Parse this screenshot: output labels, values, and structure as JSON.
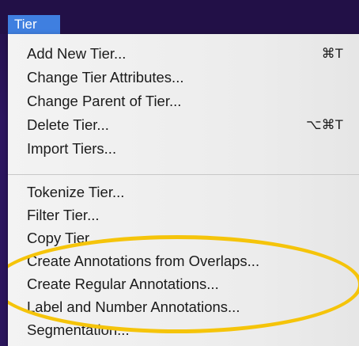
{
  "menu": {
    "title": "Tier",
    "items": [
      {
        "label": "Add New Tier...",
        "shortcut": "⌘T"
      },
      {
        "label": "Change Tier Attributes...",
        "shortcut": ""
      },
      {
        "label": "Change Parent of Tier...",
        "shortcut": ""
      },
      {
        "label": "Delete Tier...",
        "shortcut": "⌥⌘T"
      },
      {
        "label": "Import Tiers...",
        "shortcut": ""
      },
      {
        "label": "Tokenize Tier...",
        "shortcut": ""
      },
      {
        "label": "Filter Tier...",
        "shortcut": ""
      },
      {
        "label": "Copy Tier...",
        "shortcut": ""
      },
      {
        "label": "Create Annotations from Overlaps...",
        "shortcut": ""
      },
      {
        "label": "Create Regular Annotations...",
        "shortcut": ""
      },
      {
        "label": "Label and Number Annotations...",
        "shortcut": ""
      },
      {
        "label": "Segmentation...",
        "shortcut": ""
      }
    ]
  },
  "colors": {
    "menu_title_bg": "#3f7fe0",
    "highlight_ellipse": "#f5c40a",
    "background": "#2a1458"
  }
}
